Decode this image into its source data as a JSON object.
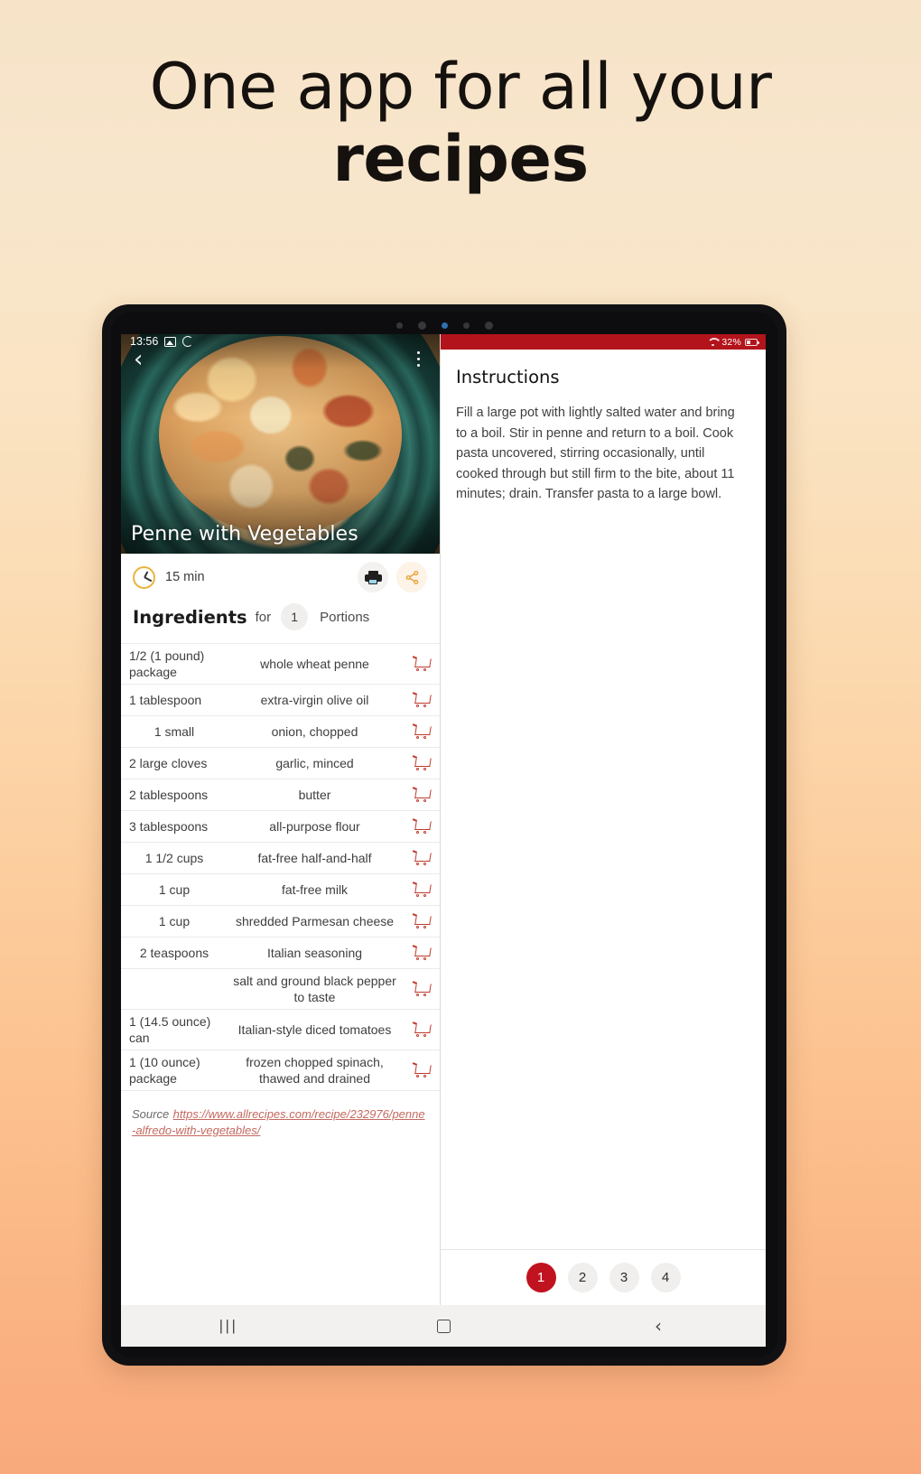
{
  "promo": {
    "line1": "One app for all your",
    "line2": "recipes"
  },
  "colors": {
    "accent_red": "#c1121f",
    "status_bar_red": "#b3131a",
    "link_red": "#c4695f",
    "clock_gold": "#e8b53f"
  },
  "device": {
    "status_bar": {
      "time": "13:56",
      "image_icon": "picture-icon",
      "sync_icon": "sync-icon",
      "wifi_icon": "wifi-icon",
      "battery_text": "32%",
      "battery_icon": "battery-icon"
    },
    "nav_bar": {
      "recents": "|||",
      "home": "home-square-icon",
      "back": "back-chevron-icon"
    }
  },
  "recipe": {
    "back_icon": "chevron-left-icon",
    "overflow_icon": "more-vertical-icon",
    "title": "Penne with Vegetables",
    "time_icon": "clock-icon",
    "time": "15 min",
    "print_icon": "printer-icon",
    "share_icon": "share-icon",
    "ingredients_heading": "Ingredients",
    "for_label": "for",
    "portions_value": "1",
    "portions_label": "Portions",
    "cart_icon": "shopping-cart-icon",
    "ingredients": [
      {
        "qty": "1/2 (1 pound) package",
        "name": "whole wheat penne"
      },
      {
        "qty": "1 tablespoon",
        "name": "extra-virgin olive oil"
      },
      {
        "qty": "1 small",
        "name": "onion, chopped"
      },
      {
        "qty": "2 large cloves",
        "name": "garlic, minced"
      },
      {
        "qty": "2 tablespoons",
        "name": "butter"
      },
      {
        "qty": "3 tablespoons",
        "name": "all-purpose flour"
      },
      {
        "qty": "1 1/2 cups",
        "name": "fat-free half-and-half"
      },
      {
        "qty": "1 cup",
        "name": "fat-free milk"
      },
      {
        "qty": "1 cup",
        "name": "shredded Parmesan cheese"
      },
      {
        "qty": "2 teaspoons",
        "name": "Italian seasoning"
      },
      {
        "qty": "",
        "name": "salt and ground black pepper to taste"
      },
      {
        "qty": "1 (14.5 ounce) can",
        "name": "Italian-style diced tomatoes"
      },
      {
        "qty": "1 (10 ounce) package",
        "name": "frozen chopped spinach, thawed and drained"
      }
    ],
    "source_label": "Source",
    "source_url": "https://www.allrecipes.com/recipe/232976/penne-alfredo-with-vegetables/"
  },
  "instructions": {
    "heading": "Instructions",
    "body": "Fill a large pot with lightly salted water and bring to a boil. Stir in penne and return to a boil. Cook pasta uncovered, stirring occasionally, until cooked through but still firm to the bite, about 11 minutes; drain. Transfer pasta to a large bowl.",
    "pages": [
      {
        "label": "1",
        "active": true
      },
      {
        "label": "2",
        "active": false
      },
      {
        "label": "3",
        "active": false
      },
      {
        "label": "4",
        "active": false
      }
    ]
  }
}
